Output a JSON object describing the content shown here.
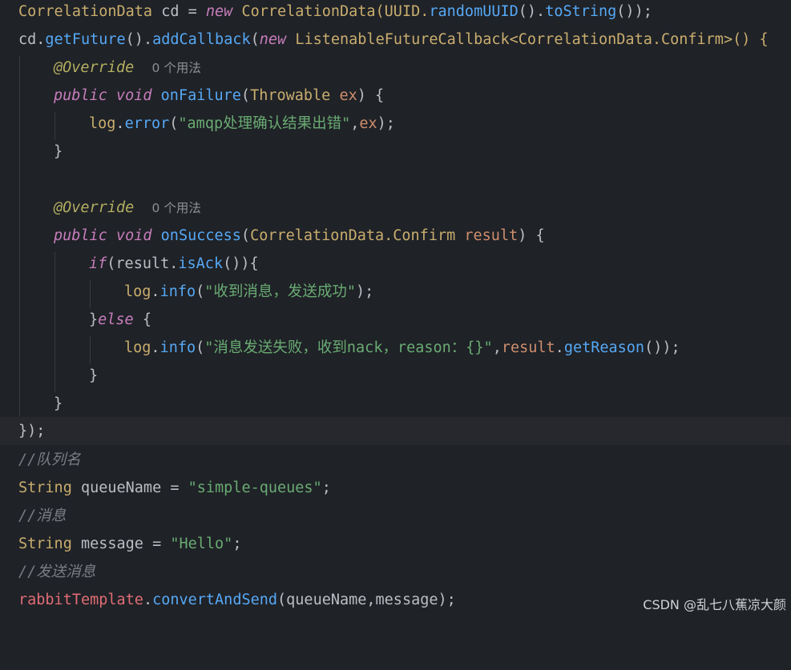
{
  "editor": {
    "colors": {
      "background": "#1f2227",
      "current_line": "#26282e",
      "keyword": "#c77dbb",
      "method": "#56a8f5",
      "string": "#6aab73",
      "comment": "#7a7e85",
      "annotation": "#b3ae60",
      "type": "#c9ad6e"
    },
    "line1": {
      "t1": "CorrelationData",
      "t2": " cd = ",
      "t3": "new",
      "t4": " CorrelationData(UUID.",
      "t5": "randomUUID",
      "t6": "().",
      "t7": "toString",
      "t8": "());"
    },
    "line2": {
      "t1": "cd.",
      "t2": "getFuture",
      "t3": "().",
      "t4": "addCallback",
      "t5": "(",
      "t6": "new",
      "t7": " ListenableFutureCallback<CorrelationData.Confirm>() {"
    },
    "line3": {
      "ann": "@Override",
      "usage": "0 个用法"
    },
    "line4": {
      "t1": "public",
      "t2": "void",
      "t3": "onFailure",
      "t4": "(",
      "t5": "Throwable",
      "t6": "ex",
      "t7": ") {"
    },
    "line5": {
      "t1": "log",
      "t2": ".",
      "t3": "error",
      "t4": "(",
      "t5": "\"amqp处理确认结果出错\"",
      "t6": ",",
      "t7": "ex",
      "t8": ");"
    },
    "line6": {
      "t1": "}"
    },
    "line8": {
      "ann": "@Override",
      "usage": "0 个用法"
    },
    "line9": {
      "t1": "public",
      "t2": "void",
      "t3": "onSuccess",
      "t4": "(",
      "t5": "CorrelationData.Confirm",
      "t6": "result",
      "t7": ") {"
    },
    "line10": {
      "t1": "if",
      "t2": "(result.",
      "t3": "isAck",
      "t4": "()){"
    },
    "line11": {
      "t1": "log",
      "t2": ".",
      "t3": "info",
      "t4": "(",
      "t5": "\"收到消息，发送成功\"",
      "t6": ");"
    },
    "line12": {
      "t1": "}",
      "t2": "else",
      "t3": " {"
    },
    "line13": {
      "t1": "log",
      "t2": ".",
      "t3": "info",
      "t4": "(",
      "t5": "\"消息发送失败，收到nack，reason：{}\"",
      "t6": ",",
      "t7": "result",
      "t8": ".",
      "t9": "getReason",
      "t10": "());"
    },
    "line14": {
      "t1": "}"
    },
    "line15": {
      "t1": "}"
    },
    "line16": {
      "t1": "});"
    },
    "line17": {
      "t1": "//队列名"
    },
    "line18": {
      "t1": "String",
      "t2": " queueName = ",
      "t3": "\"simple-queues\"",
      "t4": ";"
    },
    "line19": {
      "t1": "//消息"
    },
    "line20": {
      "t1": "String",
      "t2": " message = ",
      "t3": "\"Hello\"",
      "t4": ";"
    },
    "line21": {
      "t1": "//发送消息"
    },
    "line22": {
      "t1": "rabbitTemplate",
      "t2": ".",
      "t3": "convertAndSend",
      "t4": "(queueName,message);"
    }
  },
  "watermark": "CSDN @乱七八蕉凉大颜"
}
